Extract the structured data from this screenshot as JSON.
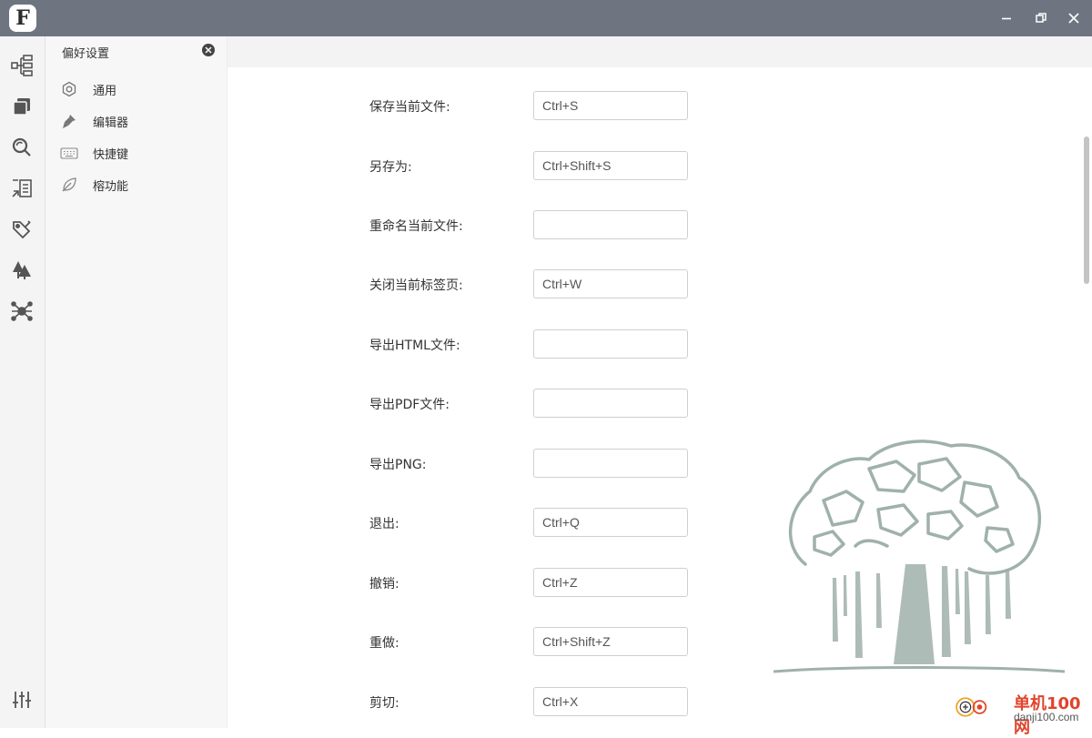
{
  "app": {
    "logo_letter": "F"
  },
  "window_controls": [
    "minimize",
    "restore",
    "close"
  ],
  "iconbar": {
    "items": [
      {
        "name": "mindmap-icon"
      },
      {
        "name": "files-icon"
      },
      {
        "name": "search-icon"
      },
      {
        "name": "outline-icon"
      },
      {
        "name": "tag-icon"
      },
      {
        "name": "tree-icon"
      },
      {
        "name": "network-icon"
      }
    ],
    "bottom": {
      "name": "settings-sliders-icon"
    }
  },
  "preferences": {
    "title": "偏好设置",
    "items": [
      {
        "label": "通用",
        "icon": "hexagon-gear-icon"
      },
      {
        "label": "编辑器",
        "icon": "pen-icon"
      },
      {
        "label": "快捷键",
        "icon": "keyboard-icon"
      },
      {
        "label": "榕功能",
        "icon": "leaf-icon"
      }
    ]
  },
  "shortcuts": [
    {
      "label": "保存当前文件:",
      "value": "Ctrl+S"
    },
    {
      "label": "另存为:",
      "value": "Ctrl+Shift+S"
    },
    {
      "label": "重命名当前文件:",
      "value": ""
    },
    {
      "label": "关闭当前标签页:",
      "value": "Ctrl+W"
    },
    {
      "label": "导出HTML文件:",
      "value": ""
    },
    {
      "label": "导出PDF文件:",
      "value": ""
    },
    {
      "label": "导出PNG:",
      "value": ""
    },
    {
      "label": "退出:",
      "value": "Ctrl+Q"
    },
    {
      "label": "撤销:",
      "value": "Ctrl+Z"
    },
    {
      "label": "重做:",
      "value": "Ctrl+Shift+Z"
    },
    {
      "label": "剪切:",
      "value": "Ctrl+X"
    }
  ],
  "watermark": {
    "name": "单机100网",
    "url": "danji100.com"
  },
  "colors": {
    "titlebar": "#6f7580",
    "accent_red": "#e0442c",
    "tree": "#9fb1aa"
  }
}
